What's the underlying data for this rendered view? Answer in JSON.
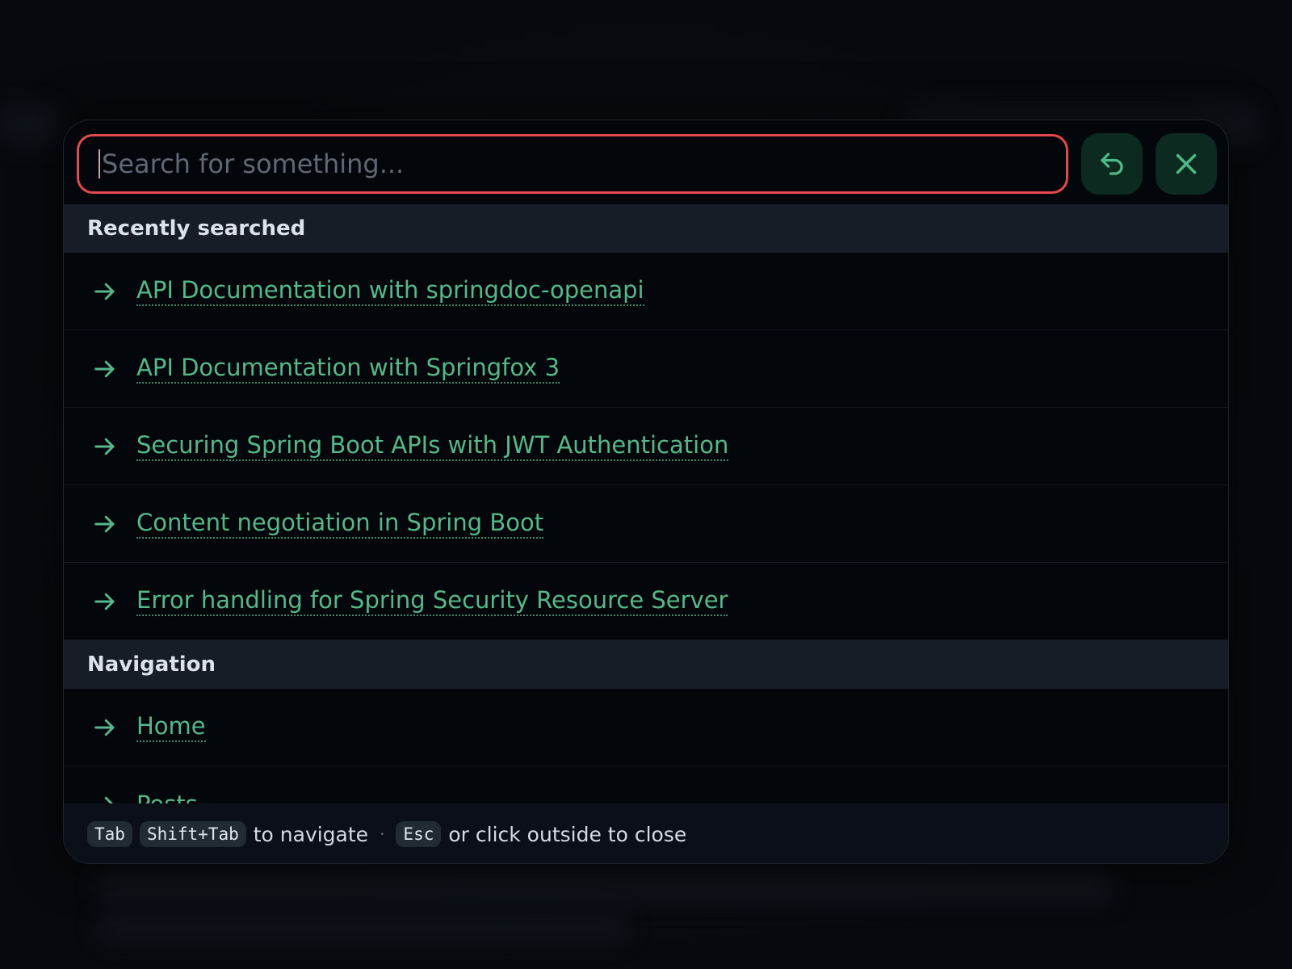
{
  "search": {
    "placeholder": "Search for something...",
    "value": "",
    "back_button": "undo-icon",
    "close_button": "close-icon"
  },
  "sections": {
    "recent": {
      "title": "Recently searched",
      "items": [
        {
          "label": "API Documentation with springdoc-openapi"
        },
        {
          "label": "API Documentation with Springfox 3"
        },
        {
          "label": "Securing Spring Boot APIs with JWT Authentication"
        },
        {
          "label": "Content negotiation in Spring Boot"
        },
        {
          "label": "Error handling for Spring Security Resource Server"
        }
      ]
    },
    "navigation": {
      "title": "Navigation",
      "items": [
        {
          "label": "Home"
        },
        {
          "label": "Posts"
        }
      ]
    }
  },
  "footer": {
    "tab_key": "Tab",
    "shift_tab_key": "Shift+Tab",
    "navigate_text": "to navigate",
    "separator": "·",
    "esc_key": "Esc",
    "close_text": "or click outside to close"
  },
  "colors": {
    "accent": "#55b88a",
    "focus_ring": "#e5484d",
    "button_bg": "#0c2a1f",
    "section_bg": "#161d26"
  }
}
